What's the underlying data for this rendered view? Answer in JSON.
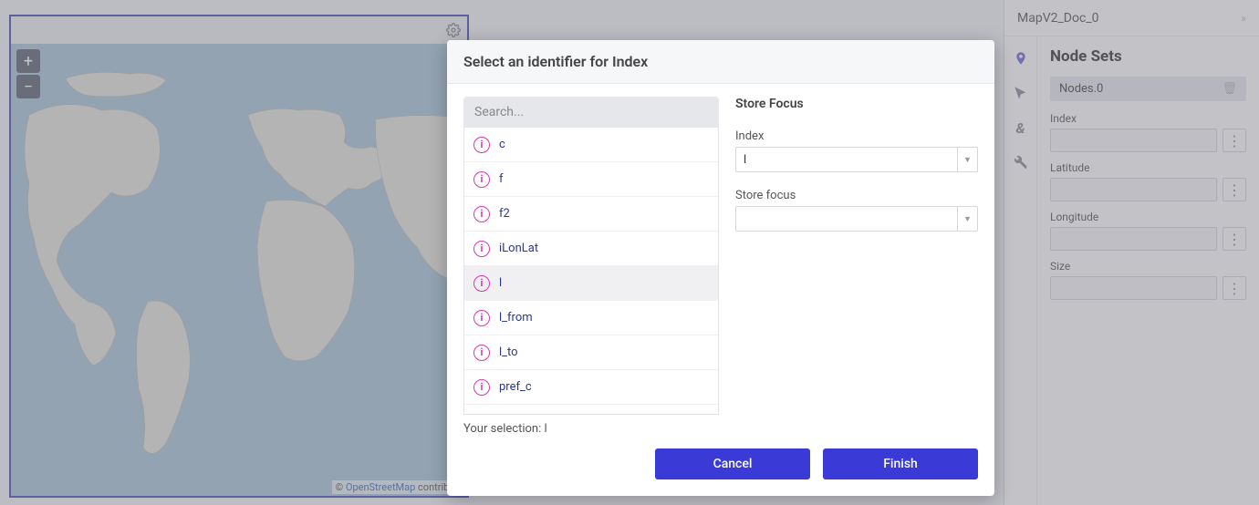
{
  "map": {
    "attribution_prefix": "© ",
    "attribution_link": "OpenStreetMap",
    "attribution_suffix": " contribut",
    "zoom_in": "+",
    "zoom_out": "−"
  },
  "right_panel": {
    "title": "MapV2_Doc_0",
    "section_title": "Node Sets",
    "chip": "Nodes.0",
    "fields": [
      "Index",
      "Latitude",
      "Longitude",
      "Size"
    ]
  },
  "modal": {
    "title": "Select an identifier for Index",
    "search_placeholder": "Search...",
    "identifiers": [
      "c",
      "f",
      "f2",
      "iLonLat",
      "l",
      "l_from",
      "l_to",
      "pref_c"
    ],
    "selected_identifier": "l",
    "store_focus_title": "Store Focus",
    "index_label": "Index",
    "index_value": "l",
    "store_focus_label": "Store focus",
    "store_focus_value": "",
    "selection_label": "Your selection:  ",
    "selection_value": "l",
    "cancel": "Cancel",
    "finish": "Finish"
  }
}
